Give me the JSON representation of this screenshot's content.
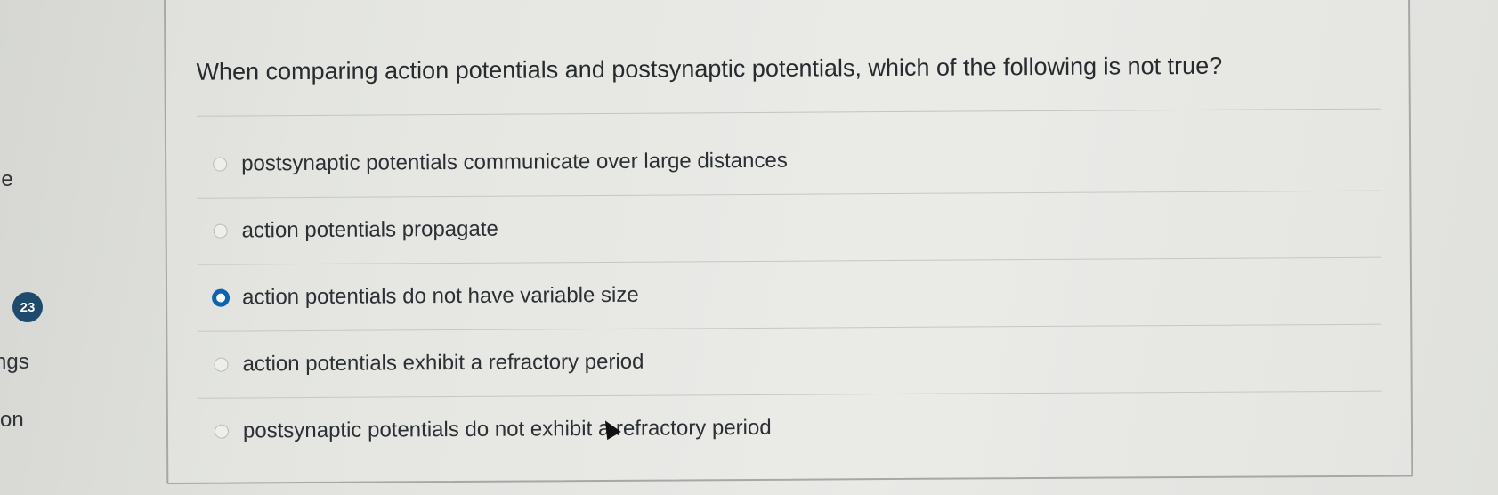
{
  "sidebar": {
    "items": [
      {
        "label": "le"
      },
      {
        "label": "23"
      },
      {
        "label": "ngs"
      },
      {
        "label": "on"
      }
    ]
  },
  "quiz": {
    "question": "When comparing action potentials and postsynaptic potentials, which of the following is not true?",
    "selected_index": 2,
    "answers": [
      {
        "label": "postsynaptic potentials communicate over large distances",
        "selected": false
      },
      {
        "label": "action potentials propagate",
        "selected": false
      },
      {
        "label": "action potentials do not have variable size",
        "selected": true
      },
      {
        "label": "action potentials exhibit a refractory period",
        "selected": false
      },
      {
        "label": "postsynaptic potentials do not exhibit a refractory period",
        "selected": false
      }
    ]
  },
  "colors": {
    "selected_radio": "#0c63b3",
    "badge": "#1e4a6e"
  },
  "icons": {
    "cursor": "mouse-pointer-icon",
    "radio": "radio-button-icon"
  }
}
